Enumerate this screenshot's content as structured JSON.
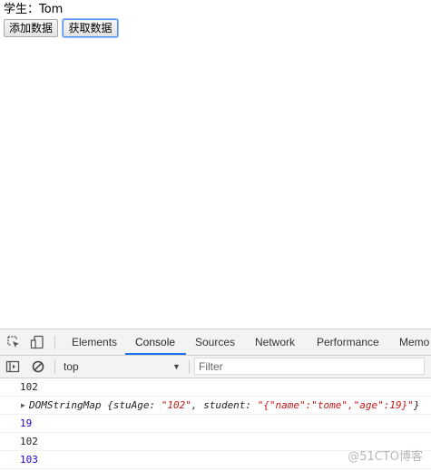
{
  "page": {
    "student_label": "学生：Tom",
    "add_button": "添加数据",
    "get_button": "获取数据"
  },
  "devtools": {
    "tabs": [
      "Elements",
      "Console",
      "Sources",
      "Network",
      "Performance",
      "Memo"
    ],
    "active_tab": "Console",
    "context": "top",
    "filter_placeholder": "Filter",
    "icons": [
      "inspect-element-icon",
      "device-toolbar-icon",
      "sidebar-toggle-icon",
      "clear-console-icon"
    ]
  },
  "console": {
    "line1": "102",
    "obj_prefix": "DOMStringMap {stuAge: ",
    "obj_val1": "\"102\"",
    "obj_mid": ", student: ",
    "obj_val2": "\"{\"name\":\"tome\",\"age\":19}\"",
    "obj_suffix": "}",
    "line3": "19",
    "line4": "102",
    "line5": "103"
  },
  "watermark": "@51CTO博客"
}
